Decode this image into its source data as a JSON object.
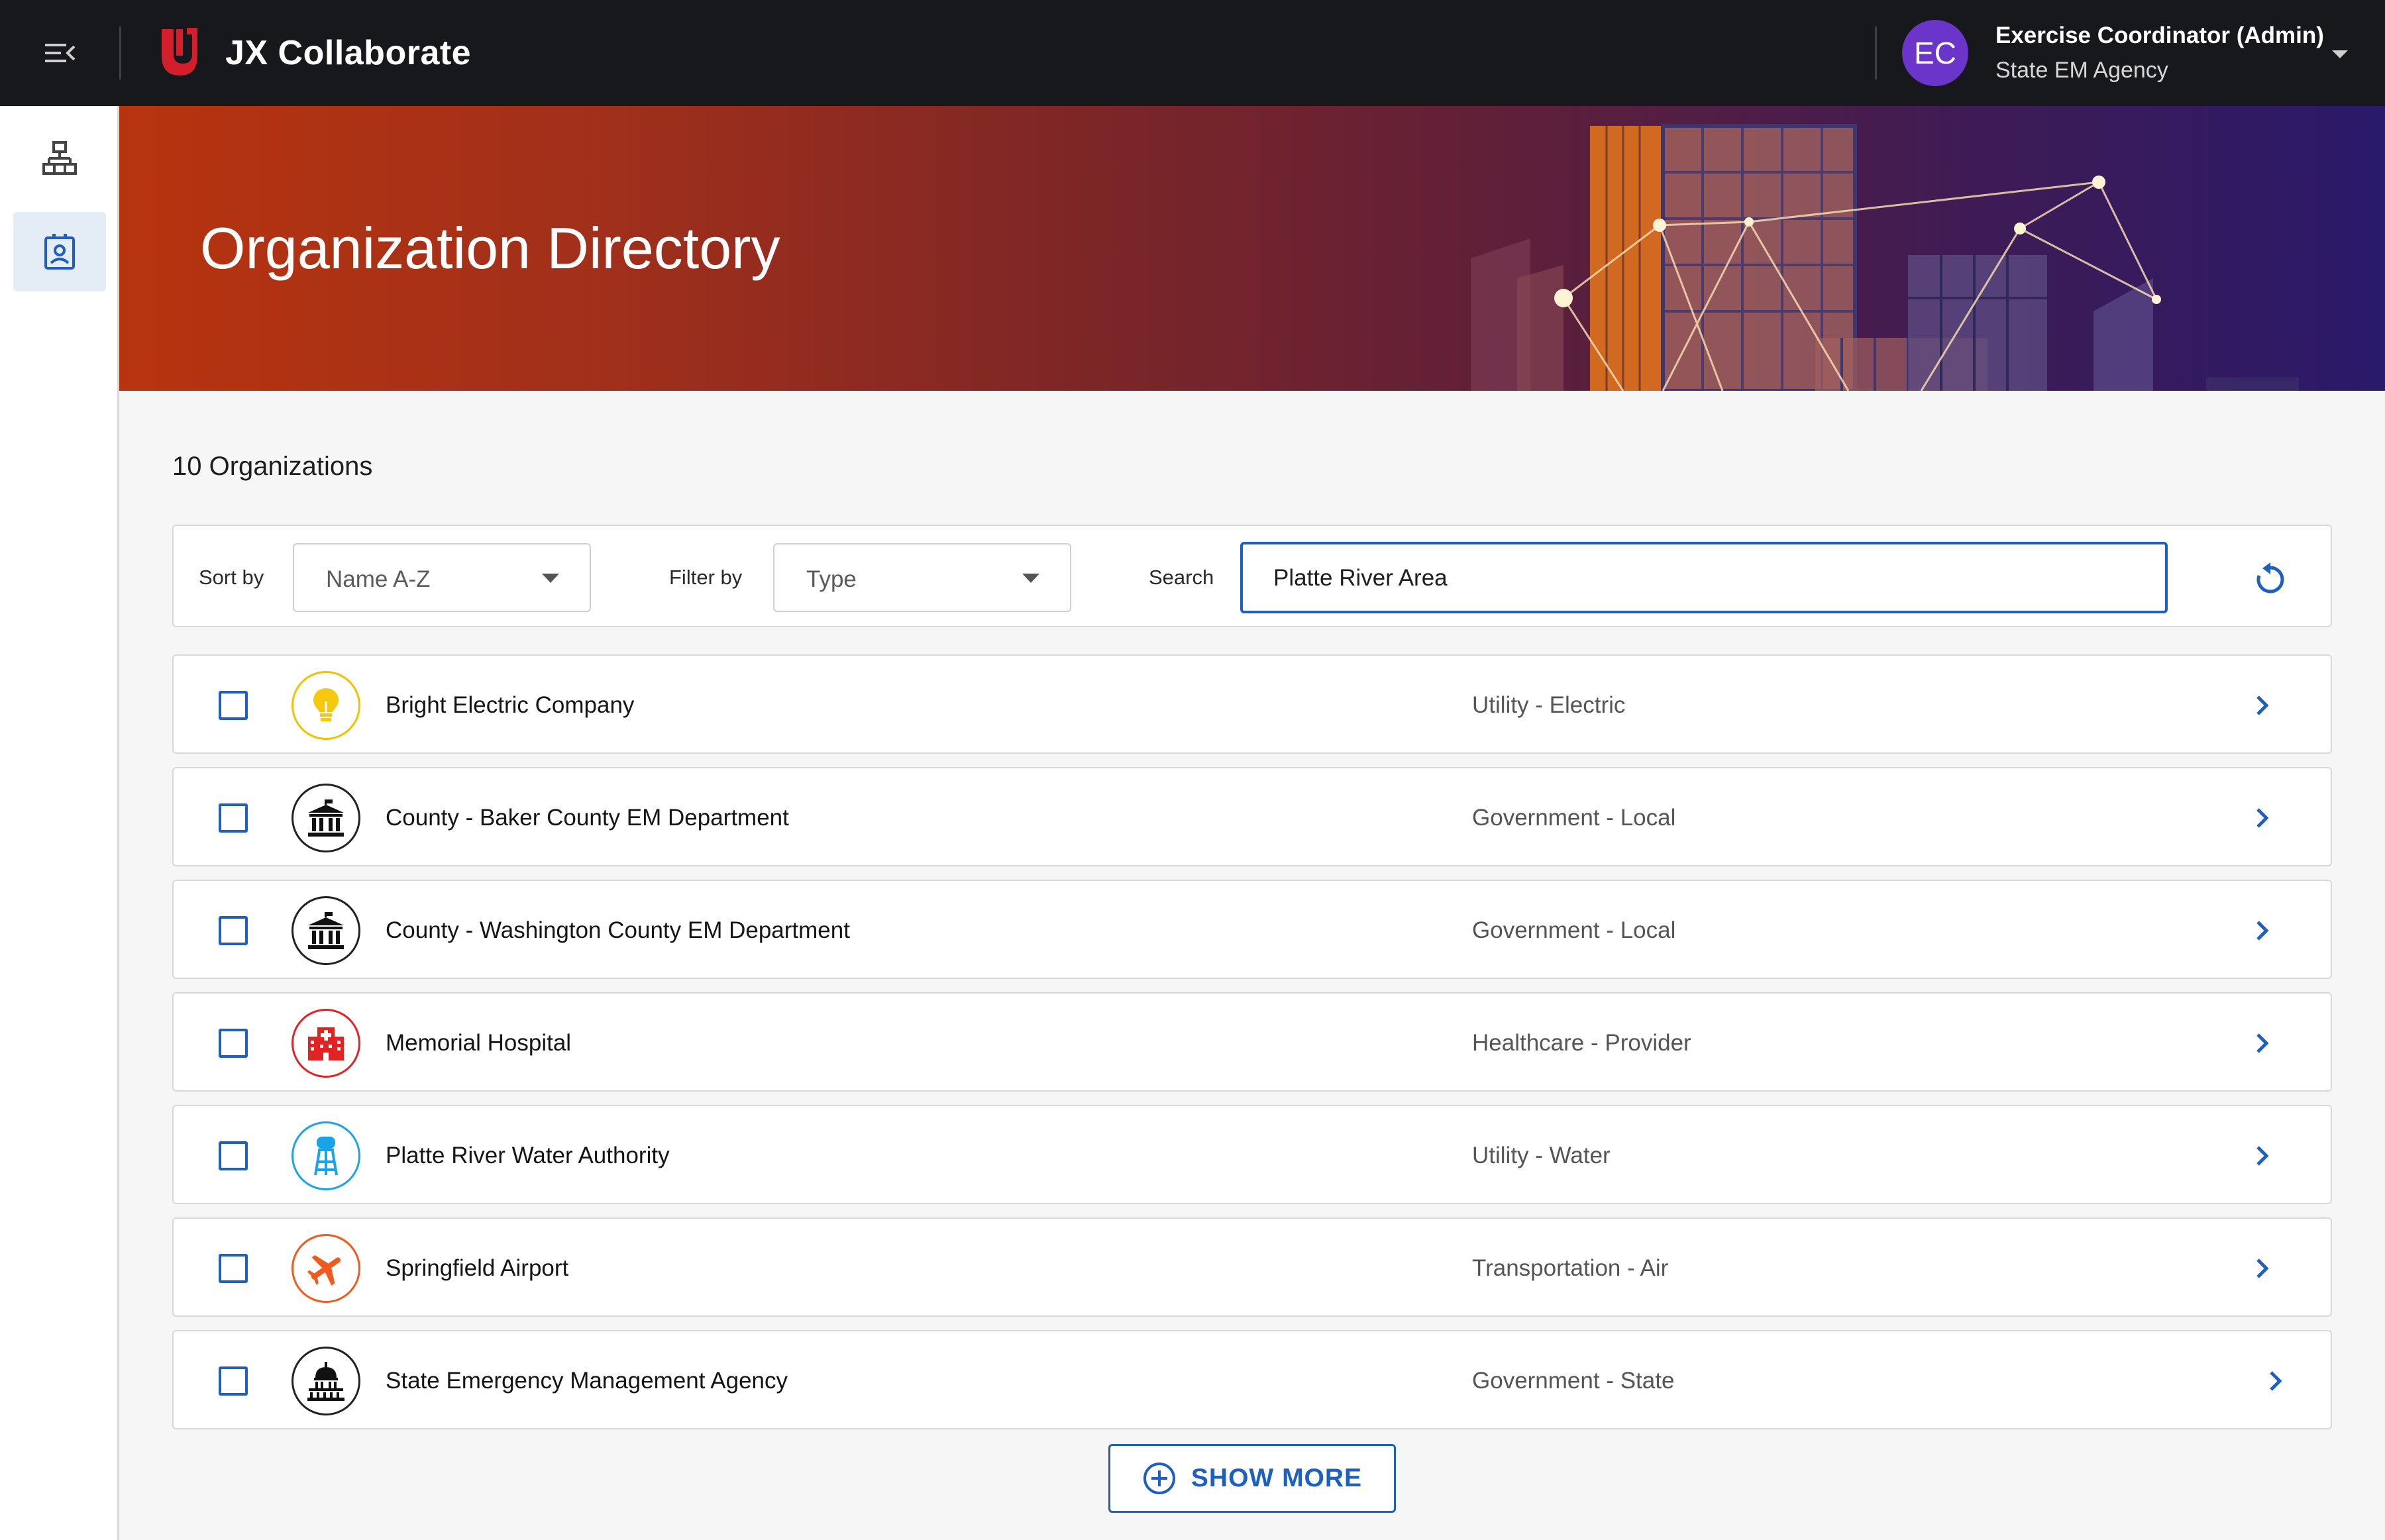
{
  "app": {
    "title": "JX Collaborate"
  },
  "user": {
    "initials": "EC",
    "name": "Exercise Coordinator (Admin)",
    "org": "State EM Agency",
    "avatar_color": "#6a35c8"
  },
  "sidebar": {
    "items": [
      {
        "icon": "org-chart-icon",
        "active": false
      },
      {
        "icon": "contact-card-icon",
        "active": true
      }
    ]
  },
  "hero": {
    "title": "Organization Directory"
  },
  "list": {
    "count_label": "10 Organizations"
  },
  "filters": {
    "sort_label": "Sort by",
    "sort_value": "Name A-Z",
    "filter_label": "Filter by",
    "filter_value": "Type",
    "search_label": "Search",
    "search_value": "Platte River Area"
  },
  "organizations": [
    {
      "name": "Bright Electric Company",
      "type": "Utility - Electric",
      "icon": "lightbulb-icon",
      "color": "#f2c200"
    },
    {
      "name": "County - Baker County EM Department",
      "type": "Government - Local",
      "icon": "courthouse-icon",
      "color": "#111111"
    },
    {
      "name": "County - Washington County EM Department",
      "type": "Government - Local",
      "icon": "courthouse-icon",
      "color": "#111111"
    },
    {
      "name": "Memorial Hospital",
      "type": "Healthcare - Provider",
      "icon": "hospital-icon",
      "color": "#e02424"
    },
    {
      "name": "Platte River Water Authority",
      "type": "Utility - Water",
      "icon": "water-tower-icon",
      "color": "#1aa3e8"
    },
    {
      "name": "Springfield Airport",
      "type": "Transportation - Air",
      "icon": "airplane-icon",
      "color": "#f05a1e"
    },
    {
      "name": "State Emergency Management Agency",
      "type": "Government - State",
      "icon": "capitol-icon",
      "color": "#111111"
    }
  ],
  "actions": {
    "show_more": "SHOW MORE"
  },
  "colors": {
    "accent": "#1f5fbf",
    "topbar": "#16181b",
    "brand_red": "#d21f2b"
  }
}
